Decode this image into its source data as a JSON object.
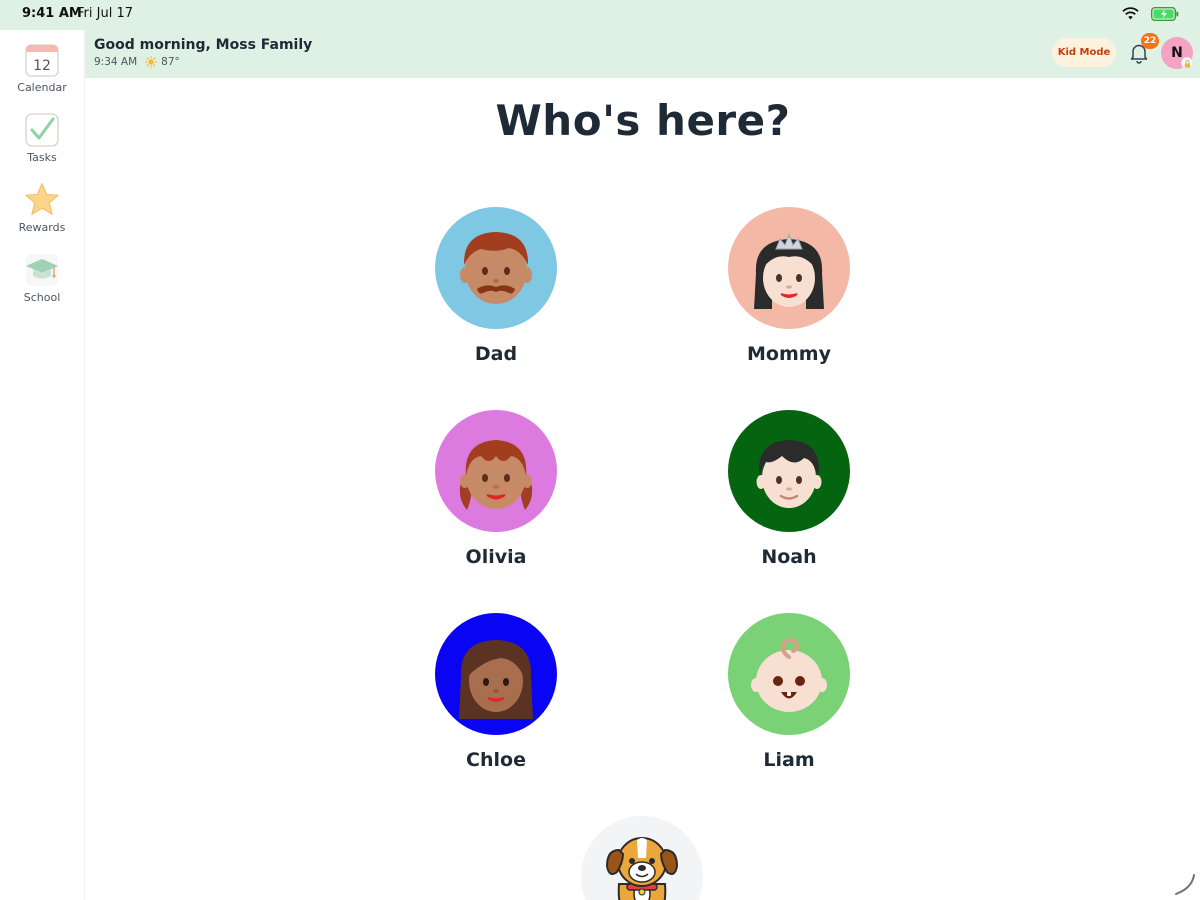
{
  "status_bar": {
    "time": "9:41 AM",
    "date": "Fri Jul 17"
  },
  "sidebar": {
    "items": [
      {
        "label": "Calendar",
        "icon": "calendar-icon",
        "day": "12"
      },
      {
        "label": "Tasks",
        "icon": "checkmark-icon"
      },
      {
        "label": "Rewards",
        "icon": "star-icon"
      },
      {
        "label": "School",
        "icon": "graduation-cap-icon"
      }
    ]
  },
  "header": {
    "greeting": "Good morning, Moss Family",
    "time": "9:34 AM",
    "temperature": "87°",
    "kid_mode_label": "Kid Mode",
    "notification_count": "22",
    "user_initial": "N"
  },
  "main": {
    "title": "Who's here?",
    "members": [
      {
        "name": "Dad",
        "color": "#7ec8e3"
      },
      {
        "name": "Mommy",
        "color": "#f4b8a6"
      },
      {
        "name": "Olivia",
        "color": "#dd7ae0"
      },
      {
        "name": "Noah",
        "color": "#05640f"
      },
      {
        "name": "Chloe",
        "color": "#0a04f5"
      },
      {
        "name": "Liam",
        "color": "#7bd175"
      }
    ]
  }
}
